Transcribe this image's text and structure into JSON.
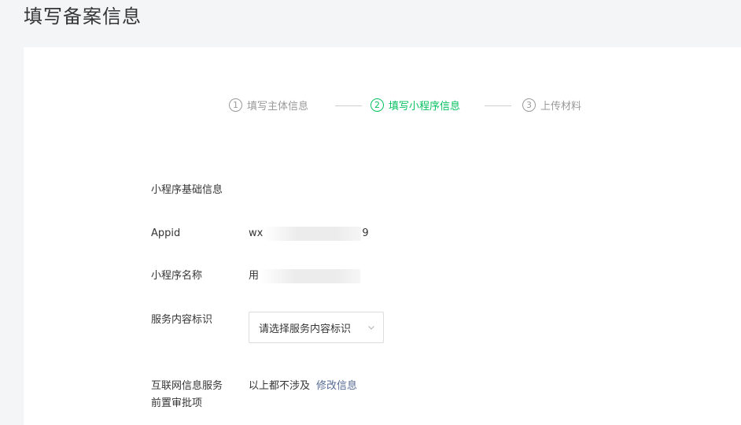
{
  "page": {
    "title": "填写备案信息"
  },
  "steps": [
    {
      "number": "1",
      "label": "填写主体信息",
      "state": "done"
    },
    {
      "number": "2",
      "label": "填写小程序信息",
      "state": "active"
    },
    {
      "number": "3",
      "label": "上传材料",
      "state": "pending"
    }
  ],
  "colors": {
    "active": "#07c160",
    "link": "#576b95",
    "inactive": "#9a9a9a"
  },
  "form": {
    "section_title": "小程序基础信息",
    "appid": {
      "label": "Appid",
      "value_prefix": "wx",
      "value_suffix": "9"
    },
    "name": {
      "label": "小程序名称",
      "value_prefix": "用"
    },
    "service_tag": {
      "label": "服务内容标识",
      "select_value": "请选择服务内容标识",
      "icon": "chevron-down-icon"
    },
    "internet_service": {
      "label_line1": "互联网信息服务",
      "label_line2": "前置审批项",
      "value": "以上都不涉及",
      "link": "修改信息"
    }
  }
}
